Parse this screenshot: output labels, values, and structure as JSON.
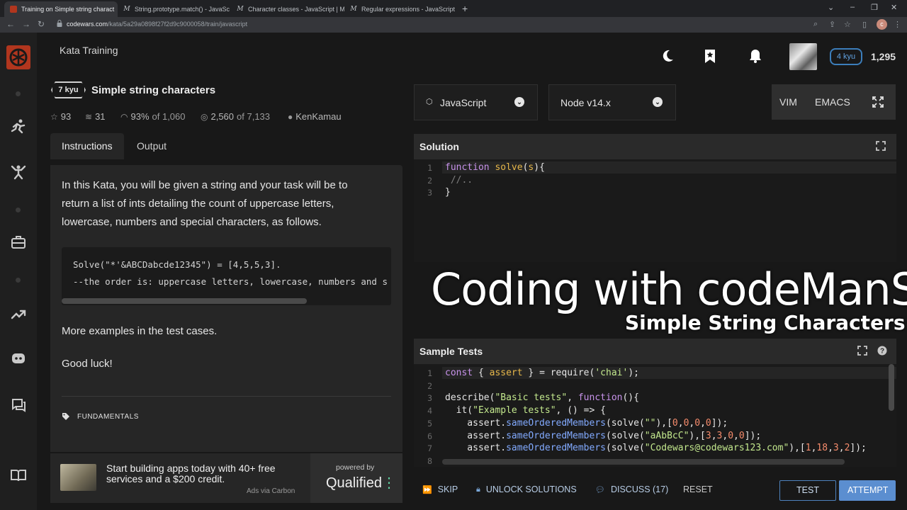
{
  "browser": {
    "tabs": [
      {
        "title": "Training on Simple string charact",
        "active": true
      },
      {
        "title": "String.prototype.match() - JavaSc",
        "active": false
      },
      {
        "title": "Character classes - JavaScript | M",
        "active": false
      },
      {
        "title": "Regular expressions - JavaScript",
        "active": false
      }
    ],
    "url_domain": "codewars.com",
    "url_path": "/kata/5a29a0898f27f2d9c9000058/train/javascript",
    "profile_initial": "c"
  },
  "header": {
    "title": "Kata Training",
    "rank": "4 kyu",
    "honor": "1,295"
  },
  "kata": {
    "kyu": "7 kyu",
    "name": "Simple string characters",
    "stars": "93",
    "collections": "31",
    "satisfaction_pct": "93%",
    "satisfaction_of": "of 1,060",
    "completed": "2,560",
    "completed_of": "of 7,133",
    "author": "KenKamau"
  },
  "panel_tabs": {
    "instructions": "Instructions",
    "output": "Output"
  },
  "instructions": {
    "line1": "In this Kata, you will be given a string and your task will be to",
    "line2": "return a list of ints detailing the count of uppercase letters,",
    "line3": "lowercase, numbers and special characters, as follows.",
    "code1": "Solve(\"*'&ABCDabcde12345\") = [4,5,5,3].",
    "code2": "--the order is: uppercase letters, lowercase, numbers and s",
    "more": "More examples in the test cases.",
    "luck": "Good luck!",
    "tag": "FUNDAMENTALS"
  },
  "ad": {
    "text": "Start building apps today with 40+ free services and a $200 credit.",
    "via": "Ads via Carbon",
    "powered": "powered by",
    "brand": "Qualified"
  },
  "editor_toolbar": {
    "language": "JavaScript",
    "runtime": "Node v14.x",
    "vim": "VIM",
    "emacs": "EMACS"
  },
  "solution": {
    "title": "Solution",
    "lines": [
      "1",
      "2",
      "3"
    ]
  },
  "sample_tests": {
    "title": "Sample Tests",
    "lines": [
      "1",
      "2",
      "3",
      "4",
      "5",
      "6",
      "7",
      "8"
    ]
  },
  "overlay": {
    "title": "Coding with codeManS",
    "subtitle": "Simple String Characters"
  },
  "bottom": {
    "skip": "SKIP",
    "unlock": "UNLOCK SOLUTIONS",
    "discuss": "DISCUSS (17)",
    "reset": "RESET",
    "test": "TEST",
    "attempt": "ATTEMPT"
  },
  "colors": {
    "brand": "#b1361e",
    "accent_blue": "#5b8ed0",
    "background": "#181818"
  }
}
